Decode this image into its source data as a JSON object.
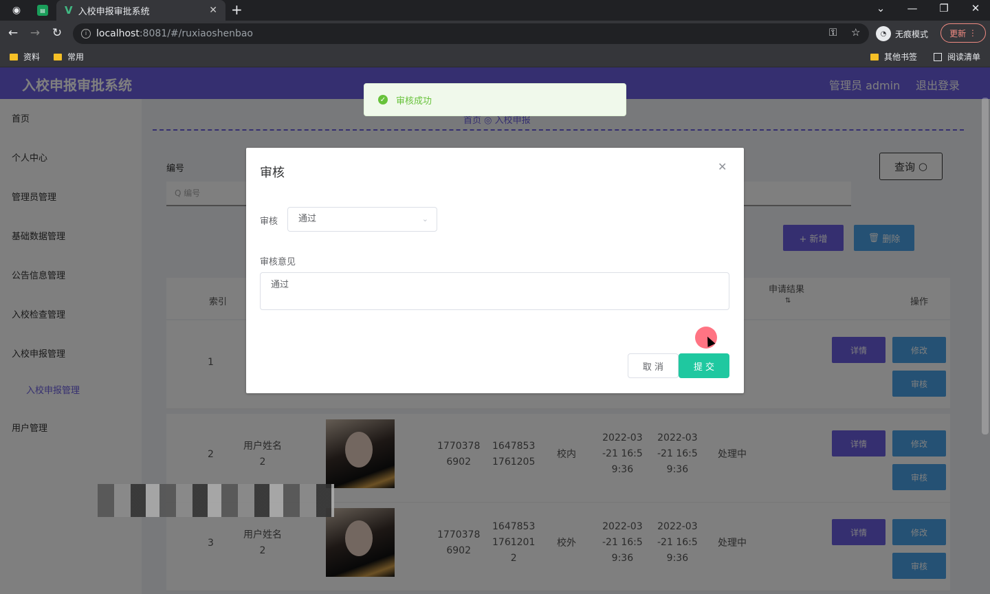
{
  "browser": {
    "tab_title": "入校申报审批系统",
    "url_host": "localhost",
    "url_path": ":8081/#/ruxiaoshenbao",
    "incognito_label": "无痕模式",
    "update_label": "更新",
    "bookmarks": [
      "资料",
      "常用"
    ],
    "bookmarks_right": [
      "其他书签",
      "阅读清单"
    ]
  },
  "header": {
    "system_title": "入校申报审批系统",
    "admin_label": "管理员 admin",
    "logout_label": "退出登录"
  },
  "sidebar": {
    "items": [
      "首页",
      "个人中心",
      "管理员管理",
      "基础数据管理",
      "公告信息管理",
      "入校检查管理",
      "入校申报管理"
    ],
    "sub_item": "入校申报管理",
    "last_item": "用户管理"
  },
  "content": {
    "breadcrumb": "首页 ◎ 入校申报",
    "search_label": "编号",
    "search_placeholder": "Q 编号",
    "query_label": "查询",
    "add_label": "+ 新增",
    "delete_label": "删除",
    "table_headers": {
      "index": "索引",
      "result": "申请结果",
      "ops": "操作"
    },
    "rows": [
      {
        "index": "1",
        "name": "",
        "phone": "",
        "code": "",
        "place": "",
        "t1": "",
        "t2": "",
        "status": ""
      },
      {
        "index": "2",
        "name": "用户姓名\n2",
        "phone": "1770378\n6902",
        "code": "1647853\n1761205",
        "place": "校内",
        "t1": "2022-03\n-21 16:5\n9:36",
        "t2": "2022-03\n-21 16:5\n9:36",
        "status": "处理中"
      },
      {
        "index": "3",
        "name": "用户姓名\n2",
        "phone": "1770378\n6902",
        "code": "1647853\n1761201\n2",
        "place": "校外",
        "t1": "2022-03\n-21 16:5\n9:36",
        "t2": "2022-03\n-21 16:5\n9:36",
        "status": "处理中"
      }
    ],
    "op_labels": {
      "detail": "详情",
      "edit": "修改",
      "audit": "审核"
    }
  },
  "toast": {
    "message": "审核成功"
  },
  "dialog": {
    "title": "审核",
    "audit_label": "审核",
    "audit_value": "通过",
    "opinion_label": "审核意见",
    "opinion_value": "通过",
    "cancel_label": "取 消",
    "submit_label": "提 交"
  }
}
